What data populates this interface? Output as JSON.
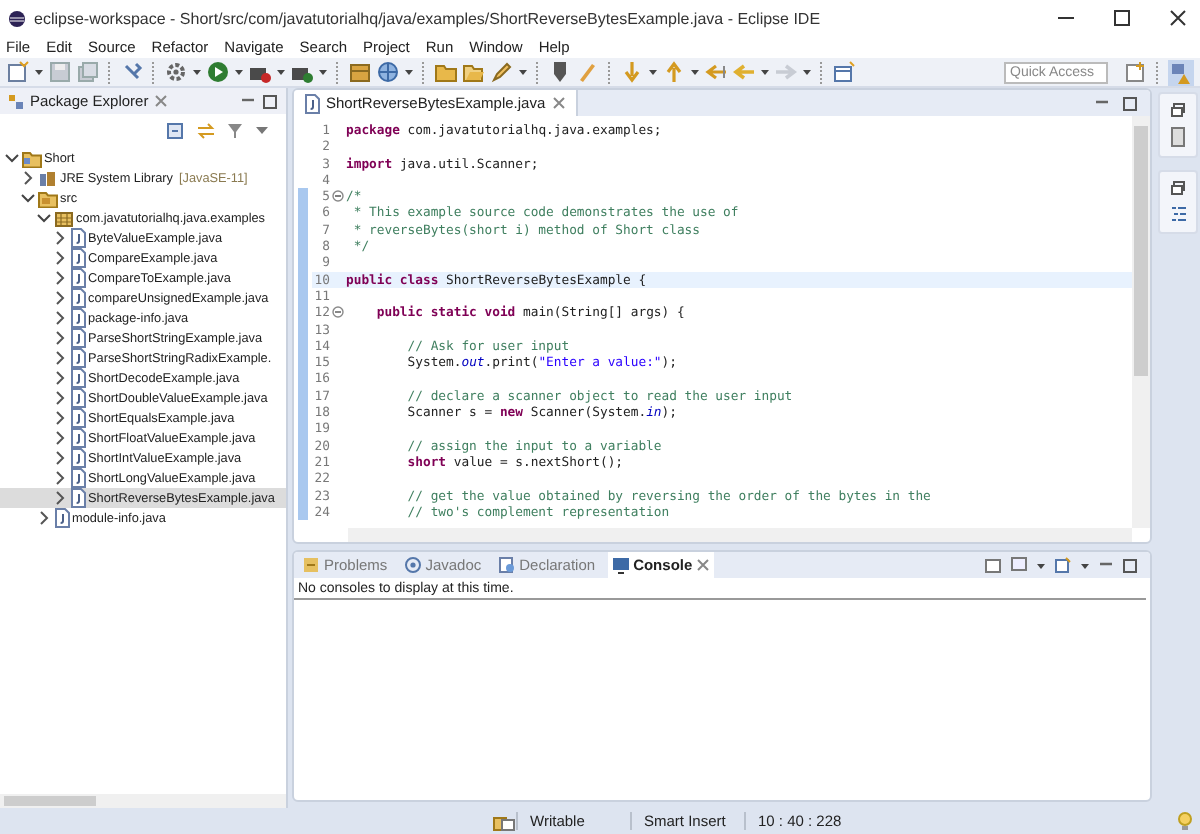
{
  "window": {
    "title": "eclipse-workspace - Short/src/com/javatutorialhq/java/examples/ShortReverseBytesExample.java - Eclipse IDE"
  },
  "menu": [
    "File",
    "Edit",
    "Source",
    "Refactor",
    "Navigate",
    "Search",
    "Project",
    "Run",
    "Window",
    "Help"
  ],
  "toolbar": {
    "quick_access": {
      "placeholder": "Quick Access"
    }
  },
  "explorer": {
    "title": "Package Explorer",
    "tree": [
      {
        "label": "Short",
        "kind": "project",
        "expanded": true,
        "selected": false,
        "children": [
          {
            "label": "JRE System Library",
            "decoration": "[JavaSE-11]",
            "kind": "library",
            "expanded": false,
            "selected": false
          },
          {
            "label": "src",
            "kind": "folder",
            "expanded": true,
            "selected": false,
            "children": [
              {
                "label": "com.javatutorialhq.java.examples",
                "kind": "package",
                "expanded": true,
                "selected": false,
                "children": [
                  {
                    "label": "ByteValueExample.java",
                    "kind": "file",
                    "expanded": false,
                    "selected": false
                  },
                  {
                    "label": "CompareExample.java",
                    "kind": "file",
                    "expanded": false,
                    "selected": false
                  },
                  {
                    "label": "CompareToExample.java",
                    "kind": "file",
                    "expanded": false,
                    "selected": false
                  },
                  {
                    "label": "compareUnsignedExample.java",
                    "kind": "file",
                    "expanded": false,
                    "selected": false
                  },
                  {
                    "label": "package-info.java",
                    "kind": "file",
                    "expanded": false,
                    "selected": false
                  },
                  {
                    "label": "ParseShortStringExample.java",
                    "kind": "file",
                    "expanded": false,
                    "selected": false
                  },
                  {
                    "label": "ParseShortStringRadixExample.",
                    "kind": "file",
                    "expanded": false,
                    "selected": false
                  },
                  {
                    "label": "ShortDecodeExample.java",
                    "kind": "file",
                    "expanded": false,
                    "selected": false
                  },
                  {
                    "label": "ShortDoubleValueExample.java",
                    "kind": "file",
                    "expanded": false,
                    "selected": false
                  },
                  {
                    "label": "ShortEqualsExample.java",
                    "kind": "file",
                    "expanded": false,
                    "selected": false
                  },
                  {
                    "label": "ShortFloatValueExample.java",
                    "kind": "file",
                    "expanded": false,
                    "selected": false
                  },
                  {
                    "label": "ShortIntValueExample.java",
                    "kind": "file",
                    "expanded": false,
                    "selected": false
                  },
                  {
                    "label": "ShortLongValueExample.java",
                    "kind": "file",
                    "expanded": false,
                    "selected": false
                  },
                  {
                    "label": "ShortReverseBytesExample.java",
                    "kind": "file",
                    "expanded": false,
                    "selected": true
                  }
                ]
              },
              {
                "label": "module-info.java",
                "kind": "file",
                "expanded": false,
                "selected": false
              }
            ]
          }
        ]
      }
    ]
  },
  "editor": {
    "tab": {
      "label": "ShortReverseBytesExample.java",
      "selected": true
    },
    "lines": [
      {
        "number": "1",
        "fold": false,
        "current": false,
        "tokens": [
          {
            "kind": "keyword",
            "text": "package"
          },
          {
            "kind": "plain",
            "text": " com.javatutorialhq.java.examples;"
          }
        ]
      },
      {
        "number": "2",
        "fold": false,
        "current": false
      },
      {
        "number": "3",
        "fold": false,
        "current": false,
        "tokens": [
          {
            "kind": "keyword",
            "text": "import"
          },
          {
            "kind": "plain",
            "text": " java.util.Scanner;"
          }
        ]
      },
      {
        "number": "4",
        "fold": false,
        "current": false
      },
      {
        "number": "5",
        "fold": true,
        "current": false,
        "tokens": [
          {
            "kind": "comment",
            "text": "/*"
          }
        ]
      },
      {
        "number": "6",
        "fold": false,
        "current": false,
        "tokens": [
          {
            "kind": "comment",
            "text": " * This example source code demonstrates the use of"
          }
        ]
      },
      {
        "number": "7",
        "fold": false,
        "current": false,
        "tokens": [
          {
            "kind": "comment",
            "text": " * reverseBytes(short i) method of Short class"
          }
        ]
      },
      {
        "number": "8",
        "fold": false,
        "current": false,
        "tokens": [
          {
            "kind": "comment",
            "text": " */"
          }
        ]
      },
      {
        "number": "9",
        "fold": false,
        "current": false
      },
      {
        "number": "10",
        "fold": false,
        "current": true,
        "tokens": [
          {
            "kind": "keyword",
            "text": "public class"
          },
          {
            "kind": "plain",
            "text": " ShortReverseBytesExample {"
          }
        ]
      },
      {
        "number": "11",
        "fold": false,
        "current": false
      },
      {
        "number": "12",
        "fold": true,
        "current": false,
        "tokens": [
          {
            "kind": "keyword",
            "text": "    public static void"
          },
          {
            "kind": "plain",
            "text": " main(String[] args) {"
          }
        ]
      },
      {
        "number": "13",
        "fold": false,
        "current": false
      },
      {
        "number": "14",
        "fold": false,
        "current": false,
        "tokens": [
          {
            "kind": "comment",
            "text": "        // Ask for user input"
          }
        ]
      },
      {
        "number": "15",
        "fold": false,
        "current": false,
        "tokens": [
          {
            "kind": "plain",
            "text": "        System."
          },
          {
            "kind": "field",
            "text": "out"
          },
          {
            "kind": "plain",
            "text": ".print("
          },
          {
            "kind": "string",
            "text": "\"Enter a value:\""
          },
          {
            "kind": "plain",
            "text": ");"
          }
        ]
      },
      {
        "number": "16",
        "fold": false,
        "current": false
      },
      {
        "number": "17",
        "fold": false,
        "current": false,
        "tokens": [
          {
            "kind": "comment",
            "text": "        // declare a scanner object to read the user input"
          }
        ]
      },
      {
        "number": "18",
        "fold": false,
        "current": false,
        "tokens": [
          {
            "kind": "plain",
            "text": "        Scanner s = "
          },
          {
            "kind": "keyword",
            "text": "new"
          },
          {
            "kind": "plain",
            "text": " Scanner(System."
          },
          {
            "kind": "field",
            "text": "in"
          },
          {
            "kind": "plain",
            "text": ");"
          }
        ]
      },
      {
        "number": "19",
        "fold": false,
        "current": false
      },
      {
        "number": "20",
        "fold": false,
        "current": false,
        "tokens": [
          {
            "kind": "comment",
            "text": "        // assign the input to a variable"
          }
        ]
      },
      {
        "number": "21",
        "fold": false,
        "current": false,
        "tokens": [
          {
            "kind": "keyword",
            "text": "        short"
          },
          {
            "kind": "plain",
            "text": " value = s.nextShort();"
          }
        ]
      },
      {
        "number": "22",
        "fold": false,
        "current": false
      },
      {
        "number": "23",
        "fold": false,
        "current": false,
        "tokens": [
          {
            "kind": "comment",
            "text": "        // get the value obtained by reversing the order of the bytes in the"
          }
        ]
      },
      {
        "number": "24",
        "fold": false,
        "current": false,
        "tokens": [
          {
            "kind": "comment",
            "text": "        // two's complement representation"
          }
        ]
      }
    ]
  },
  "bottom_panel": {
    "tabs": [
      {
        "label": "Problems",
        "selected": false
      },
      {
        "label": "Javadoc",
        "selected": false
      },
      {
        "label": "Declaration",
        "selected": false
      },
      {
        "label": "Console",
        "selected": true
      }
    ],
    "message": "No consoles to display at this time."
  },
  "status_bar": [
    "Writable",
    "Smart Insert",
    "10 : 40 : 228"
  ]
}
